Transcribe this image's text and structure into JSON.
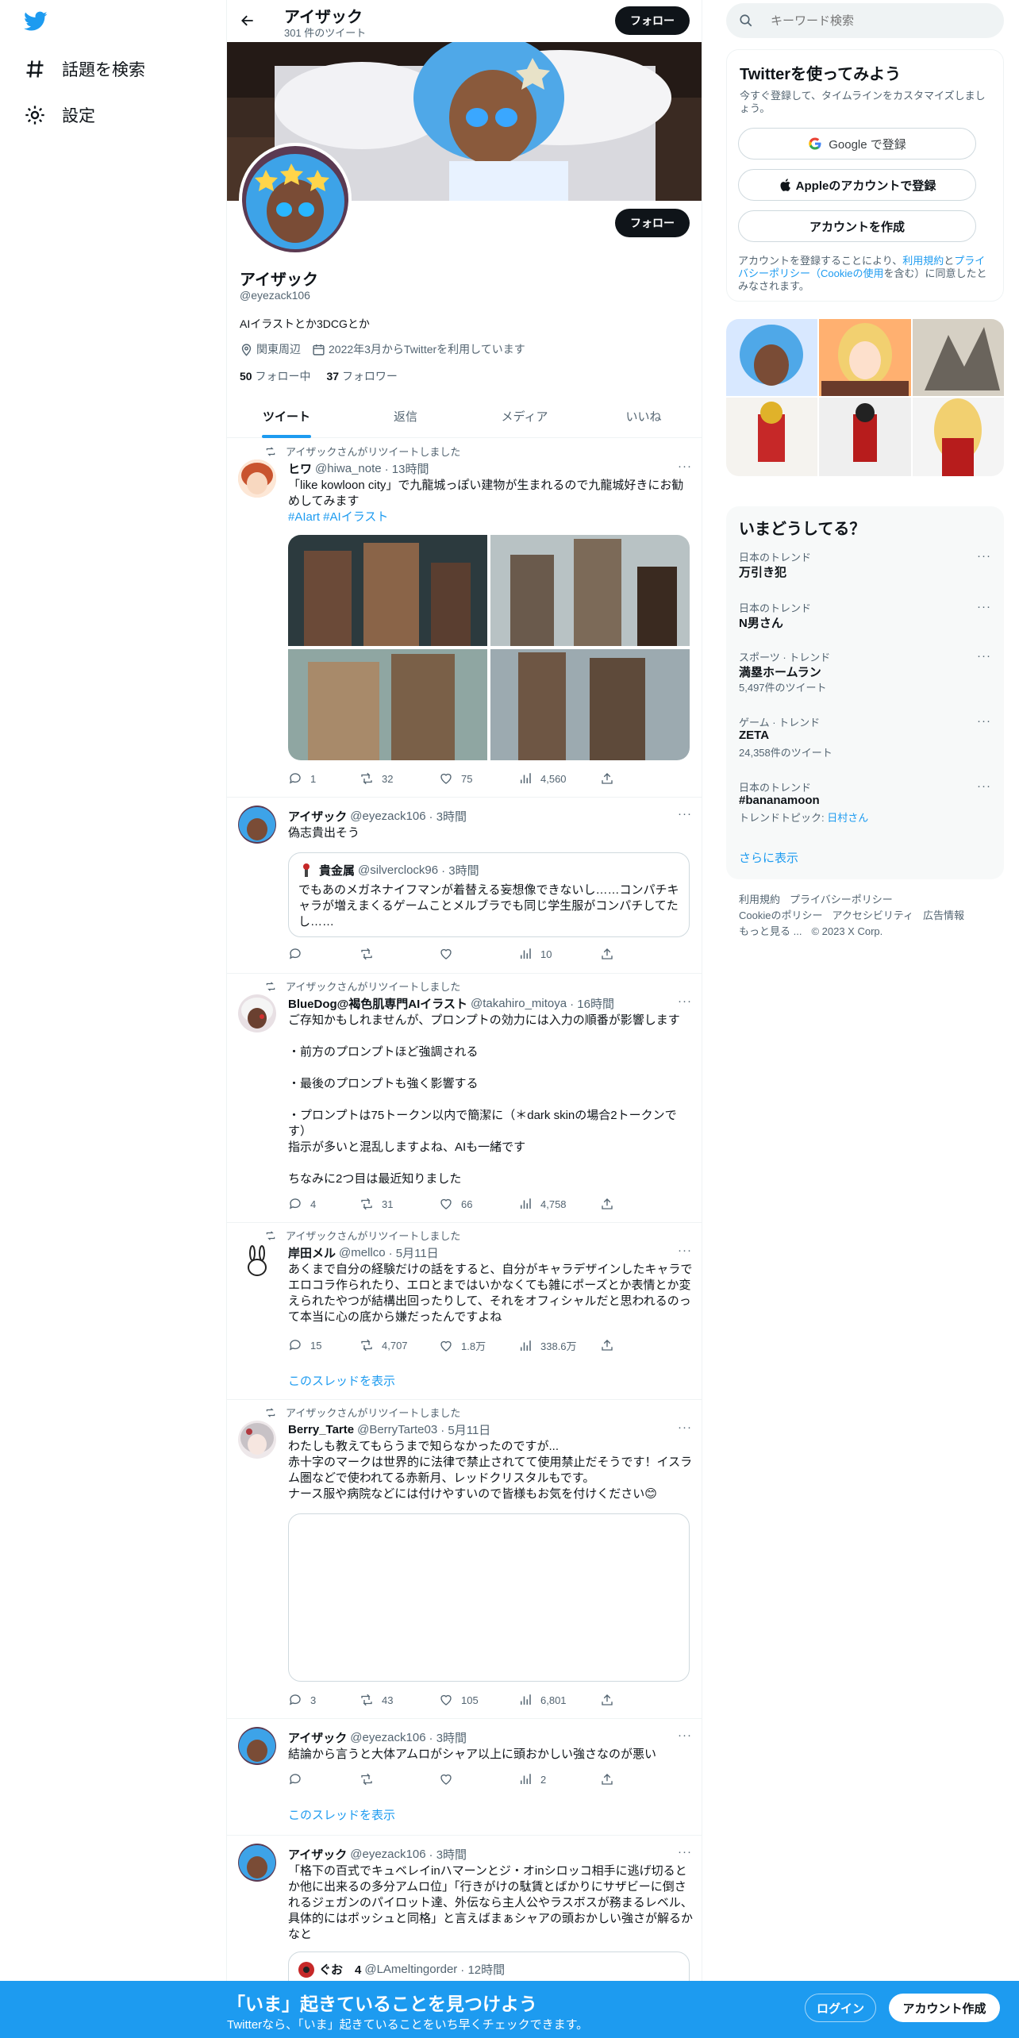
{
  "left_nav": {
    "explore": "話題を検索",
    "settings": "設定"
  },
  "header": {
    "name": "アイザック",
    "tweet_count": "301 件のツイート",
    "follow": "フォロー"
  },
  "profile": {
    "name": "アイザック",
    "handle": "@eyezack106",
    "bio": "AIイラストとか3DCGとか",
    "location": "関東周辺",
    "joined": "2022年3月からTwitterを利用しています",
    "following_count": "50",
    "following_label": "フォロー中",
    "followers_count": "37",
    "followers_label": "フォロワー",
    "follow": "フォロー"
  },
  "tabs": [
    "ツイート",
    "返信",
    "メディア",
    "いいね"
  ],
  "tweets": [
    {
      "retweeted_by": "アイザックさんがリツイートしました",
      "name": "ヒワ",
      "handle": "@hiwa_note",
      "time": "· 13時間",
      "text": "「like kowloon city」で九龍城っぽい建物が生まれるので九龍城好きにお勧めしてみます",
      "tags": "#AIart #AIイラスト",
      "replies": "1",
      "retweets": "32",
      "likes": "75",
      "views": "4,560"
    },
    {
      "name": "アイザック",
      "handle": "@eyezack106",
      "time": "· 3時間",
      "text": "偽志貴出そう",
      "quote": {
        "name": "貴金属",
        "handle": "@silverclock96",
        "time": "· 3時間",
        "text": "でもあのメガネナイフマンが着替える妄想像できないし……コンパチキャラが増えまくるゲームことメルブラでも同じ学生服がコンパチしてたし……"
      },
      "replies": "",
      "retweets": "",
      "likes": "",
      "views": "10"
    },
    {
      "retweeted_by": "アイザックさんがリツイートしました",
      "name": "BlueDog@褐色肌専門AIイラスト",
      "handle": "@takahiro_mitoya",
      "time": "· 16時間",
      "text": "ご存知かもしれませんが、プロンプトの効力には入力の順番が影響します\n\n・前方のプロンプトほど強調される\n\n・最後のプロンプトも強く影響する\n\n・プロンプトは75トークン以内で簡潔に（＊dark skinの場合2トークンです）\n指示が多いと混乱しますよね、AIも一緒です\n\nちなみに2つ目は最近知りました",
      "replies": "4",
      "retweets": "31",
      "likes": "66",
      "views": "4,758"
    },
    {
      "retweeted_by": "アイザックさんがリツイートしました",
      "name": "岸田メル",
      "handle": "@mellco",
      "time": "· 5月11日",
      "text": "あくまで自分の経験だけの話をすると、自分がキャラデザインしたキャラでエロコラ作られたり、エロとまではいかなくても雑にポーズとか表情とか変えられたやつが結構出回ったりして、それをオフィシャルだと思われるのって本当に心の底から嫌だったんですよね",
      "replies": "15",
      "retweets": "4,707",
      "likes": "1.8万",
      "views": "338.6万",
      "show_thread": "このスレッドを表示"
    },
    {
      "retweeted_by": "アイザックさんがリツイートしました",
      "name": "Berry_Tarte",
      "handle": "@BerryTarte03",
      "time": "· 5月11日",
      "text": "わたしも教えてもらうまで知らなかったのですが...\n赤十字のマークは世界的に法律で禁止されてて使用禁止だそうです！イスラム圏などで使われてる赤新月、レッドクリスタルもです。\nナース服や病院などには付けやすいので皆様もお気を付けください😊",
      "replies": "3",
      "retweets": "43",
      "likes": "105",
      "views": "6,801"
    },
    {
      "name": "アイザック",
      "handle": "@eyezack106",
      "time": "· 3時間",
      "text": "結論から言うと大体アムロがシャア以上に頭おかしい強さなのが悪い",
      "replies": "",
      "retweets": "",
      "likes": "",
      "views": "2",
      "show_thread": "このスレッドを表示"
    },
    {
      "name": "アイザック",
      "handle": "@eyezack106",
      "time": "· 3時間",
      "text": "「格下の百式でキュベレイinハマーンとジ・オinシロッコ相手に逃げ切るとか他に出来るの多分アムロ位」「行きがけの駄賃とばかりにサザビーに倒されるジェガンのパイロット達、外伝なら主人公やラスボスが務まるレベル、具体的にはポッシュと同格」と言えばまぁシャアの頭おかしい強さが解るかなと",
      "quote": {
        "name": "ぐお　4",
        "handle": "@LAmeltingorder",
        "time": "· 12時間"
      }
    }
  ],
  "search": {
    "placeholder": "キーワード検索"
  },
  "signup": {
    "title": "Twitterを使ってみよう",
    "subtitle": "今すぐ登録して、タイムラインをカスタマイズしましょう。",
    "google": "Google で登録",
    "apple": "Appleのアカウントで登録",
    "create": "アカウントを作成",
    "legal_1": "アカウントを登録することにより、",
    "legal_terms": "利用規約",
    "legal_2": "と",
    "legal_privacy": "プライバシーポリシー（Cookieの使用",
    "legal_3": "を含む）に同意したとみなされます。"
  },
  "trends": {
    "title": "いまどうしてる？",
    "items": [
      {
        "context": "日本のトレンド",
        "name": "万引き犯",
        "count": ""
      },
      {
        "context": "日本のトレンド",
        "name": "N男さん",
        "count": ""
      },
      {
        "context": "スポーツ · トレンド",
        "name": "満塁ホームラン",
        "count": "5,497件のツイート"
      },
      {
        "context": "ゲーム · トレンド",
        "name": "ZETA",
        "count": "24,358件のツイート"
      },
      {
        "context": "日本のトレンド",
        "name": "#bananamoon",
        "count_prefix": "トレンドトピック: ",
        "count_link": "日村さん"
      }
    ],
    "show_more": "さらに表示"
  },
  "footer": {
    "links": [
      "利用規約",
      "プライバシーポリシー",
      "Cookieのポリシー",
      "アクセシビリティ",
      "広告情報",
      "もっと見る ...",
      "© 2023 X Corp."
    ]
  },
  "bottom_bar": {
    "title": "「いま」起きていることを見つけよう",
    "subtitle": "Twitterなら、「いま」起きていることをいち早くチェックできます。",
    "login": "ログイン",
    "signup": "アカウント作成"
  },
  "colors": {
    "accent": "#1d9bf0",
    "text": "#0f1419",
    "muted": "#536471"
  }
}
